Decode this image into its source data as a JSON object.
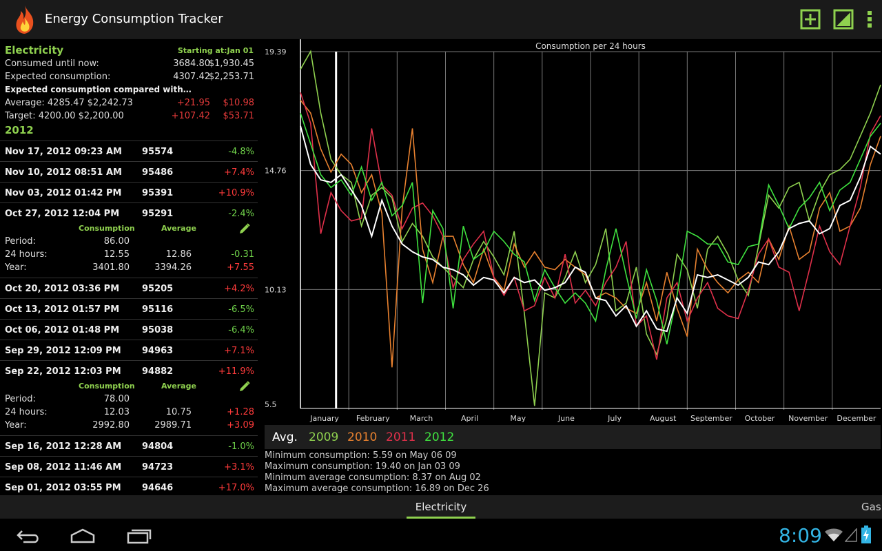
{
  "app": {
    "title": "Energy Consumption Tracker"
  },
  "actionbar": {
    "icons": [
      "add-icon",
      "chart-icon",
      "overflow-menu-icon"
    ]
  },
  "summary": {
    "title": "Electricity",
    "starting": "Starting at:Jan 01",
    "consumed_label": "Consumed until now:",
    "consumed_amount": "3684.80",
    "consumed_cost": "$1,930.45",
    "expected_label": "Expected consumption:",
    "expected_amount": "4307.42",
    "expected_cost": "$2,253.71",
    "compare_heading": "Expected consumption compared with…",
    "average_label": "Average: 4285.47  $2,242.73",
    "average_diff": "+21.95",
    "average_diff_cost": "$10.98",
    "target_label": "Target: 4200.00  $2,200.00",
    "target_diff": "+107.42",
    "target_diff_cost": "$53.71",
    "year": "2012"
  },
  "entries": [
    {
      "date": "Nov 17, 2012 09:23 AM",
      "reading": "95574",
      "change": "-4.8%",
      "color": "green"
    },
    {
      "date": "Nov 10, 2012 08:51 AM",
      "reading": "95486",
      "change": "+7.4%",
      "color": "red"
    },
    {
      "date": "Nov 03, 2012 01:42 PM",
      "reading": "95391",
      "change": "+10.9%",
      "color": "red"
    },
    {
      "date": "Oct 27, 2012 12:04 PM",
      "reading": "95291",
      "change": "-2.4%",
      "color": "green",
      "details": {
        "consumption_header": "Consumption",
        "average_header": "Average",
        "period_label": "Period:",
        "period_cons": "86.00",
        "period_avg": "",
        "period_diff": "",
        "h24_label": "24 hours:",
        "h24_cons": "12.55",
        "h24_avg": "12.86",
        "h24_diff": "-0.31",
        "year_label": "Year:",
        "year_cons": "3401.80",
        "year_avg": "3394.26",
        "year_diff": "+7.55"
      }
    },
    {
      "date": "Oct 20, 2012 03:36 PM",
      "reading": "95205",
      "change": "+4.2%",
      "color": "red"
    },
    {
      "date": "Oct 13, 2012 01:57 PM",
      "reading": "95116",
      "change": "-6.5%",
      "color": "green"
    },
    {
      "date": "Oct 06, 2012 01:48 PM",
      "reading": "95038",
      "change": "-6.4%",
      "color": "green"
    },
    {
      "date": "Sep 29, 2012 12:09 PM",
      "reading": "94963",
      "change": "+7.1%",
      "color": "red"
    },
    {
      "date": "Sep 22, 2012 12:03 PM",
      "reading": "94882",
      "change": "+11.9%",
      "color": "red",
      "details": {
        "consumption_header": "Consumption",
        "average_header": "Average",
        "period_label": "Period:",
        "period_cons": "78.00",
        "period_avg": "",
        "period_diff": "",
        "h24_label": "24 hours:",
        "h24_cons": "12.03",
        "h24_avg": "10.75",
        "h24_diff": "+1.28",
        "year_label": "Year:",
        "year_cons": "2992.80",
        "year_avg": "2989.71",
        "year_diff": "+3.09"
      }
    },
    {
      "date": "Sep 16, 2012 12:28 AM",
      "reading": "94804",
      "change": "-1.0%",
      "color": "green"
    },
    {
      "date": "Sep 08, 2012 11:46 AM",
      "reading": "94723",
      "change": "+3.1%",
      "color": "red"
    },
    {
      "date": "Sep 01, 2012 03:55 PM",
      "reading": "94646",
      "change": "+17.0%",
      "color": "red"
    }
  ],
  "legend": [
    {
      "label": "Avg.",
      "color": "#ffffff"
    },
    {
      "label": "2009",
      "color": "#8fd14f"
    },
    {
      "label": "2010",
      "color": "#e8812f"
    },
    {
      "label": "2011",
      "color": "#e0304a"
    },
    {
      "label": "2012",
      "color": "#3fe23f"
    }
  ],
  "stats": [
    "Minimum consumption: 5.59 on May 06 09",
    "Maximum consumption: 19.40 on Jan 03 09",
    "Minimum average consumption: 8.37 on Aug 02",
    "Maximum average consumption: 16.89 on Dec 26"
  ],
  "tabs": {
    "active": "Electricity",
    "next": "Gas"
  },
  "status": {
    "time": "8:09"
  },
  "chart_data": {
    "type": "line",
    "title": "Consumption per 24 hours",
    "yticks": [
      "19.39",
      "14.76",
      "10.13",
      "5.5"
    ],
    "ylim": [
      5.5,
      19.39
    ],
    "xlabels": [
      "January",
      "February",
      "March",
      "April",
      "May",
      "June",
      "July",
      "August",
      "September",
      "October",
      "November",
      "December"
    ],
    "current_marker_week": 3.5,
    "series": [
      {
        "name": "Avg.",
        "color": "#ffffff",
        "values": [
          16.5,
          15.0,
          14.4,
          14.3,
          14.6,
          14.0,
          13.4,
          12.2,
          13.6,
          12.6,
          11.9,
          11.6,
          11.4,
          11.3,
          11.0,
          10.9,
          10.7,
          10.3,
          10.6,
          10.5,
          10.0,
          10.6,
          10.4,
          10.5,
          10.1,
          10.2,
          10.4,
          11.0,
          10.8,
          9.8,
          9.7,
          9.1,
          9.5,
          8.7,
          9.3,
          8.6,
          8.5,
          9.8,
          9.2,
          10.7,
          10.6,
          10.7,
          10.5,
          10.3,
          10.6,
          11.2,
          11.1,
          11.6,
          12.5,
          12.7,
          12.8,
          12.3,
          12.5,
          13.4,
          13.6,
          14.5,
          15.7,
          15.4
        ]
      },
      {
        "name": "2009",
        "color": "#8fd14f",
        "values": [
          18.7,
          19.4,
          17.0,
          15.2,
          14.6,
          14.3,
          12.6,
          13.8,
          14.1,
          13.7,
          12.0,
          12.7,
          12.2,
          11.4,
          11.0,
          10.6,
          10.2,
          11.3,
          12.0,
          11.4,
          10.7,
          12.4,
          9.2,
          5.6,
          10.0,
          9.8,
          10.6,
          11.6,
          10.4,
          11.1,
          12.5,
          9.3,
          9.6,
          11.0,
          8.4,
          7.6,
          9.0,
          11.5,
          10.9,
          9.4,
          11.7,
          12.2,
          11.5,
          10.5,
          9.9,
          11.8,
          13.8,
          13.3,
          14.1,
          14.3,
          12.8,
          13.9,
          14.6,
          14.8,
          15.2,
          16.1,
          17.0,
          18.1
        ]
      },
      {
        "name": "2010",
        "color": "#e8812f",
        "values": [
          17.5,
          17.0,
          15.6,
          14.7,
          15.4,
          15.0,
          13.9,
          14.6,
          13.1,
          7.1,
          13.3,
          16.4,
          11.7,
          10.4,
          12.2,
          12.2,
          11.1,
          10.4,
          11.7,
          10.6,
          10.1,
          11.9,
          11.0,
          11.6,
          11.0,
          10.9,
          11.3,
          11.0,
          10.7,
          9.8,
          10.0,
          9.8,
          9.4,
          9.2,
          10.4,
          8.9,
          10.8,
          9.4,
          8.3,
          11.7,
          10.9,
          10.4,
          10.0,
          10.5,
          10.8,
          10.4,
          12.1,
          11.3,
          12.6,
          11.3,
          11.6,
          13.3,
          13.9,
          12.4,
          12.6,
          13.3,
          15.0,
          16.1
        ]
      },
      {
        "name": "2011",
        "color": "#e0304a",
        "values": [
          17.8,
          16.6,
          12.3,
          13.9,
          13.2,
          12.8,
          12.9,
          16.4,
          14.2,
          13.8,
          12.5,
          13.3,
          13.5,
          13.0,
          12.2,
          10.2,
          11.3,
          11.9,
          12.4,
          10.6,
          9.9,
          10.6,
          9.3,
          9.5,
          10.6,
          9.8,
          11.5,
          9.6,
          10.1,
          9.5,
          10.4,
          11.0,
          12.0,
          8.7,
          9.1,
          7.4,
          9.8,
          10.4,
          8.9,
          9.8,
          10.4,
          9.4,
          9.1,
          9.0,
          10.1,
          11.5,
          12.1,
          11.0,
          10.8,
          9.3,
          10.9,
          12.6,
          11.6,
          11.1,
          12.6,
          14.1,
          16.2,
          16.9
        ]
      },
      {
        "name": "2012",
        "color": "#3fe23f",
        "values": [
          17.0,
          15.8,
          14.6,
          14.1,
          14.4,
          13.8,
          14.9,
          13.6,
          14.3,
          13.0,
          13.4,
          14.3,
          9.6,
          13.2,
          12.5,
          9.4,
          12.6,
          11.3,
          11.6,
          12.4,
          12.0,
          11.5,
          11.2,
          9.7,
          10.9,
          10.2,
          9.6,
          10.0,
          9.6,
          8.9,
          10.9,
          12.5,
          10.7,
          9.0,
          10.9,
          9.7,
          8.0,
          9.9,
          12.4,
          12.2,
          11.9,
          11.9,
          11.2,
          11.1,
          11.8,
          11.9,
          14.2,
          13.4,
          12.5,
          13.3,
          13.7,
          14.3,
          13.2,
          14.0,
          14.3,
          15.2,
          16.1,
          16.6
        ]
      }
    ]
  }
}
